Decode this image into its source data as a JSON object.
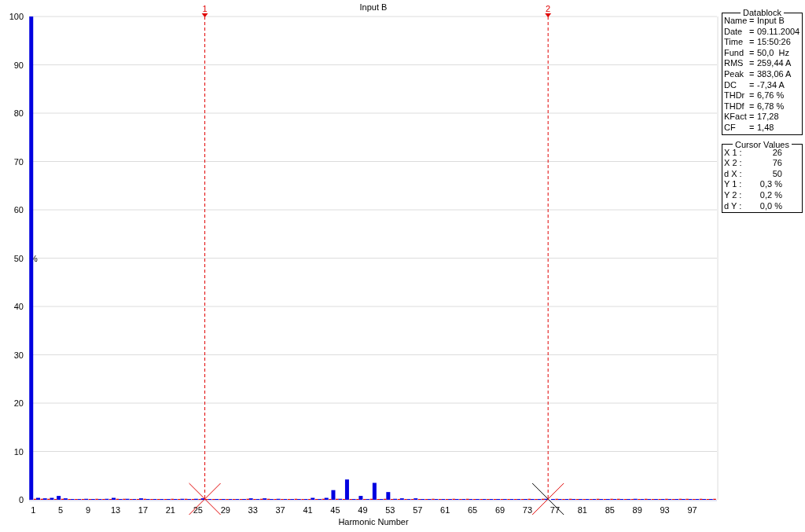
{
  "chart": {
    "chart_data": {
      "type": "bar",
      "title": "Input B",
      "xlabel": "Harmonic Number",
      "ylabel": "%",
      "x": [
        1,
        2,
        3,
        4,
        5,
        6,
        7,
        8,
        9,
        10,
        11,
        12,
        13,
        14,
        15,
        16,
        17,
        18,
        19,
        20,
        21,
        22,
        23,
        24,
        25,
        26,
        27,
        28,
        29,
        30,
        31,
        32,
        33,
        34,
        35,
        36,
        37,
        38,
        39,
        40,
        41,
        42,
        43,
        44,
        45,
        46,
        47,
        48,
        49,
        50,
        51,
        52,
        53,
        54,
        55,
        56,
        57,
        58,
        59,
        60,
        61,
        62,
        63,
        64,
        65,
        66,
        67,
        68,
        69,
        70,
        71,
        72,
        73,
        74,
        75,
        76,
        77,
        78,
        79,
        80,
        81,
        82,
        83,
        84,
        85,
        86,
        87,
        88,
        89,
        90,
        91,
        92,
        93,
        94,
        95,
        96,
        97,
        98,
        99,
        100
      ],
      "series": [
        {
          "color": "#0000e0",
          "values": [
            100,
            0.4,
            0.3,
            0.4,
            0.8,
            0.3,
            0.1,
            0.1,
            0.2,
            0.1,
            0.1,
            0.2,
            0.4,
            0.1,
            0.2,
            0.1,
            0.3,
            0.1,
            0.1,
            0.1,
            0.1,
            0.1,
            0.2,
            0.1,
            0.2,
            0.3,
            0.1,
            0.1,
            0.1,
            0.1,
            0.1,
            0.1,
            0.3,
            0.1,
            0.3,
            0.1,
            0.2,
            0.1,
            0.1,
            0.1,
            0.1,
            0.4,
            0.1,
            0.4,
            2.0,
            0.2,
            4.2,
            0.1,
            0.8,
            0.1,
            3.5,
            0.1,
            1.6,
            0.2,
            0.3,
            0.1,
            0.3,
            0.1,
            0.1,
            0.1,
            0.1,
            0.1,
            0.1,
            0.1,
            0.1,
            0.1,
            0.1,
            0.1,
            0.1,
            0.1,
            0.1,
            0.1,
            0.1,
            0.1,
            0.1,
            0.2,
            0.1,
            0.1,
            0.1,
            0.1,
            0.1,
            0.1,
            0.1,
            0.1,
            0.1,
            0.1,
            0.1,
            0.1,
            0.2,
            0.1,
            0.1,
            0.1,
            0.1,
            0.1,
            0.1,
            0.1,
            0.1,
            0.1,
            0.1,
            0.1
          ]
        },
        {
          "color": "#e00000",
          "values": [
            0.2,
            0.2,
            0.2,
            0.1,
            0.2,
            0.1,
            0.1,
            0.1,
            0.1,
            0.2,
            0.1,
            0.1,
            0.2,
            0.2,
            0.1,
            0.1,
            0.2,
            0.1,
            0.1,
            0.1,
            0.2,
            0.1,
            0.2,
            0.1,
            0.1,
            0.1,
            0.1,
            0.1,
            0.1,
            0.1,
            0.1,
            0.2,
            0.1,
            0.2,
            0.2,
            0.1,
            0.1,
            0.1,
            0.2,
            0.1,
            0.1,
            0.1,
            0.2,
            0.1,
            0.2,
            0.1,
            0.1,
            0.1,
            0.1,
            0.2,
            0.1,
            0.2,
            0.1,
            0.1,
            0.1,
            0.1,
            0.1,
            0.1,
            0.2,
            0.1,
            0.1,
            0.2,
            0.1,
            0.2,
            0.1,
            0.1,
            0.1,
            0.1,
            0.1,
            0.1,
            0.1,
            0.1,
            0.2,
            0.1,
            0.2,
            null,
            0.2,
            0.1,
            0.2,
            0.1,
            0.1,
            0.1,
            0.2,
            0.1,
            0.2,
            0.2,
            0.1,
            0.1,
            0.1,
            0.2,
            0.1,
            0.1,
            0.2,
            0.1,
            0.2,
            0.2,
            0.1,
            0.2,
            0.1,
            0.2
          ]
        }
      ],
      "xlim": [
        0.4,
        100.6
      ],
      "ylim": [
        0,
        100
      ],
      "xticks": [
        1,
        5,
        9,
        13,
        17,
        21,
        25,
        29,
        33,
        37,
        41,
        45,
        49,
        53,
        57,
        61,
        65,
        69,
        73,
        77,
        81,
        85,
        89,
        93,
        97
      ],
      "yticks": [
        0,
        10,
        20,
        30,
        40,
        50,
        60,
        70,
        80,
        90,
        100
      ],
      "grid": true,
      "ref_lines": [
        {
          "axis": "x",
          "value": 26,
          "color": "#e00000"
        },
        {
          "axis": "x",
          "value": 76,
          "color": "#e00000"
        }
      ]
    },
    "cursors": [
      {
        "number": "1"
      },
      {
        "number": "2"
      }
    ]
  },
  "datablock": {
    "title": "Datablock",
    "rows": [
      {
        "label": "Name",
        "sep": "=",
        "value": "Input B"
      },
      {
        "label": "Date",
        "sep": "=",
        "value": "09.11.2004"
      },
      {
        "label": "Time",
        "sep": "=",
        "value": "15:50:26"
      },
      {
        "label": "Fund",
        "sep": "=",
        "value": "50,0  Hz"
      },
      {
        "label": "RMS",
        "sep": "=",
        "value": "259,44 A"
      },
      {
        "label": "Peak",
        "sep": "=",
        "value": "383,06 A"
      },
      {
        "label": "DC",
        "sep": "=",
        "value": "-7,34 A"
      },
      {
        "label": "THDr",
        "sep": "=",
        "value": "6,76 %"
      },
      {
        "label": "THDf",
        "sep": "=",
        "value": "6,78 %"
      },
      {
        "label": "KFact",
        "sep": "=",
        "value": "17,28"
      },
      {
        "label": "CF",
        "sep": "=",
        "value": "1,48"
      }
    ]
  },
  "cursor_values": {
    "title": "Cursor Values",
    "rows": [
      {
        "label": "X 1 :",
        "value": "26"
      },
      {
        "label": "X 2 :",
        "value": "76"
      },
      {
        "label": "d X :",
        "value": "50"
      },
      {
        "label": "Y 1 :",
        "value": "0,3 %"
      },
      {
        "label": "Y 2 :",
        "value": "0,2 %"
      },
      {
        "label": "d Y :",
        "value": "0,0 %"
      }
    ]
  }
}
